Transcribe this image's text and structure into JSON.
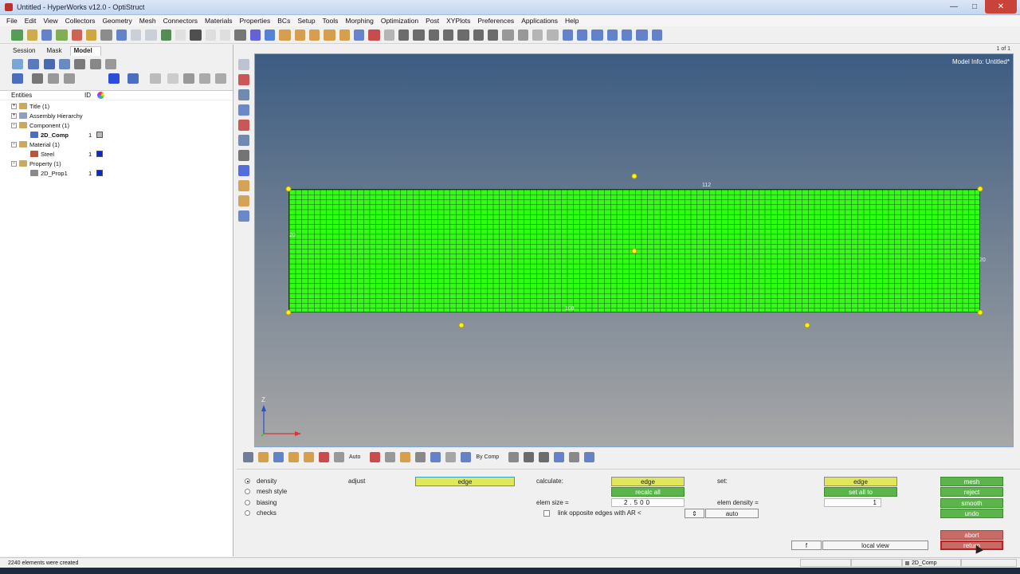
{
  "window": {
    "title": "Untitled - HyperWorks v12.0 - OptiStruct",
    "controls": [
      "—",
      "□",
      "✕"
    ]
  },
  "menu": [
    "File",
    "Edit",
    "View",
    "Collectors",
    "Geometry",
    "Mesh",
    "Connectors",
    "Materials",
    "Properties",
    "BCs",
    "Setup",
    "Tools",
    "Morphing",
    "Optimization",
    "Post",
    "XYPlots",
    "Preferences",
    "Applications",
    "Help"
  ],
  "left_panel": {
    "tabs": [
      "Session",
      "Mask",
      "Model"
    ],
    "active_tab": "Model",
    "entities_header": {
      "name": "Entities",
      "id": "ID"
    },
    "tree": [
      {
        "label": "Title (1)",
        "level": 0,
        "expand": "+",
        "num": "",
        "color": ""
      },
      {
        "label": "Assembly Hierarchy",
        "level": 0,
        "expand": "+",
        "num": "",
        "color": ""
      },
      {
        "label": "Component (1)",
        "level": 0,
        "expand": "−",
        "num": "",
        "color": ""
      },
      {
        "label": "2D_Comp",
        "level": 1,
        "expand": "",
        "num": "1",
        "color": "#b9b9b9"
      },
      {
        "label": "Material (1)",
        "level": 0,
        "expand": "−",
        "num": "",
        "color": ""
      },
      {
        "label": "Steel",
        "level": 1,
        "expand": "",
        "num": "1",
        "color": "#0d28c8"
      },
      {
        "label": "Property (1)",
        "level": 0,
        "expand": "−",
        "num": "",
        "color": ""
      },
      {
        "label": "2D_Prop1",
        "level": 1,
        "expand": "",
        "num": "1",
        "color": "#0d28c8"
      }
    ]
  },
  "viewport": {
    "page_count": "1 of 1",
    "model_info": "Model Info: Untitled*",
    "edge_labels": [
      "112",
      "20",
      "108",
      "20"
    ],
    "mesh_color": "#2fff12",
    "node_color": "#fff21e",
    "axis_label": "Z"
  },
  "bottom_toolbar": {
    "auto_label": "Auto",
    "bycomp_label": "By Comp"
  },
  "panel": {
    "options": [
      "density",
      "mesh style",
      "biasing",
      "checks"
    ],
    "selected_option": "density",
    "adjust_label": "adjust",
    "adjust_value": "edge",
    "calculate_label": "calculate:",
    "calculate_edge": "edge",
    "recalc_all": "recalc all",
    "elem_size_label": "elem size =",
    "elem_size_value": "2.500",
    "link_label": "link opposite edges with AR <",
    "auto_btn": "auto",
    "set_label": "set:",
    "set_edge": "edge",
    "set_all_to": "set all to",
    "elem_density_label": "elem density =",
    "elem_density_value": "1",
    "actions": [
      "mesh",
      "reject",
      "smooth",
      "undo"
    ],
    "abort": "abort",
    "return": "return",
    "f_btn": "f",
    "local_view": "local view"
  },
  "status": {
    "message": "2240 elements were created",
    "component": "2D_Comp"
  }
}
